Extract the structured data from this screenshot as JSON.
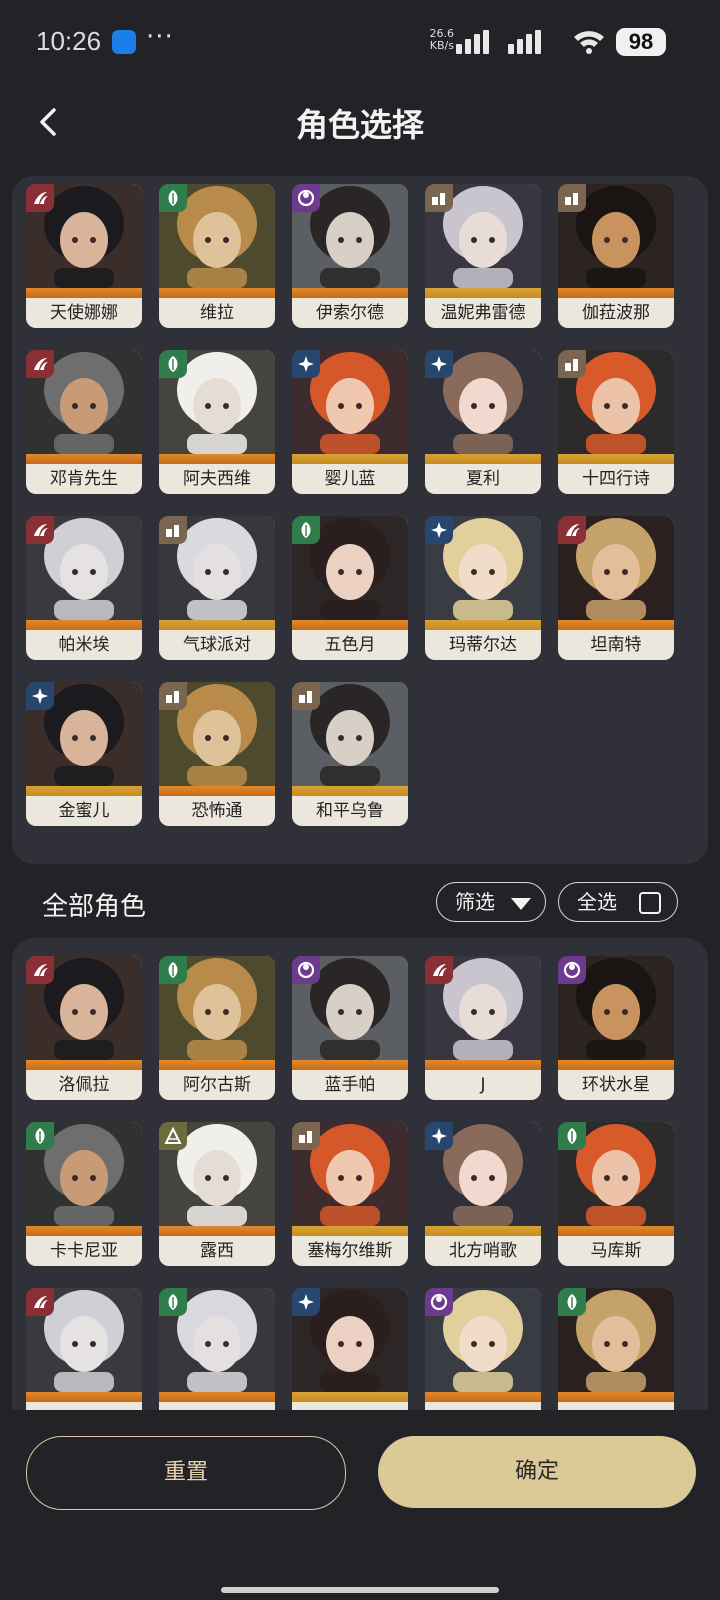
{
  "status_bar": {
    "time": "10:26",
    "more": "···",
    "net_speed_value": "26.6",
    "net_speed_unit": "KB/s",
    "battery": "98"
  },
  "header": {
    "title": "角色选择"
  },
  "selected": [
    {
      "name": "天使娜娜",
      "faction": "red"
    },
    {
      "name": "维拉",
      "faction": "green"
    },
    {
      "name": "伊索尔德",
      "faction": "purple"
    },
    {
      "name": "温妮弗雷德",
      "faction": "tan"
    },
    {
      "name": "伽菈波那",
      "faction": "tan"
    },
    {
      "name": "邓肯先生",
      "faction": "red"
    },
    {
      "name": "阿夫西维",
      "faction": "green"
    },
    {
      "name": "婴儿蓝",
      "faction": "blue"
    },
    {
      "name": "夏利",
      "faction": "blue"
    },
    {
      "name": "十四行诗",
      "faction": "tan"
    },
    {
      "name": "帕米埃",
      "faction": "red"
    },
    {
      "name": "气球派对",
      "faction": "tan"
    },
    {
      "name": "五色月",
      "faction": "green"
    },
    {
      "name": "玛蒂尔达",
      "faction": "blue"
    },
    {
      "name": "坦南特",
      "faction": "red"
    },
    {
      "name": "金蜜儿",
      "faction": "blue"
    },
    {
      "name": "恐怖通",
      "faction": "tan"
    },
    {
      "name": "和平乌鲁",
      "faction": "tan"
    }
  ],
  "all_section": {
    "title": "全部角色",
    "filter_label": "筛选",
    "select_all_label": "全选",
    "select_all_checked": false
  },
  "all": [
    {
      "name": "洛佩拉",
      "faction": "red"
    },
    {
      "name": "阿尔古斯",
      "faction": "green"
    },
    {
      "name": "蓝手帕",
      "faction": "purple"
    },
    {
      "name": "J",
      "faction": "red"
    },
    {
      "name": "环状水星",
      "faction": "purple"
    },
    {
      "name": "卡卡尼亚",
      "faction": "green"
    },
    {
      "name": "露西",
      "faction": "olive"
    },
    {
      "name": "塞梅尔维斯",
      "faction": "tan"
    },
    {
      "name": "北方哨歌",
      "faction": "blue"
    },
    {
      "name": "马库斯",
      "faction": "green"
    },
    {
      "name": "",
      "faction": "red"
    },
    {
      "name": "",
      "faction": "green"
    },
    {
      "name": "",
      "faction": "blue"
    },
    {
      "name": "",
      "faction": "purple"
    },
    {
      "name": "",
      "faction": "green"
    }
  ],
  "faction_colors": {
    "red": "#8a2f35",
    "green": "#2f7d4a",
    "purple": "#6c3a8f",
    "tan": "#7a6650",
    "blue": "#27476f",
    "olive": "#6d6a3d"
  },
  "buttons": {
    "reset": "重置",
    "confirm": "确定"
  }
}
